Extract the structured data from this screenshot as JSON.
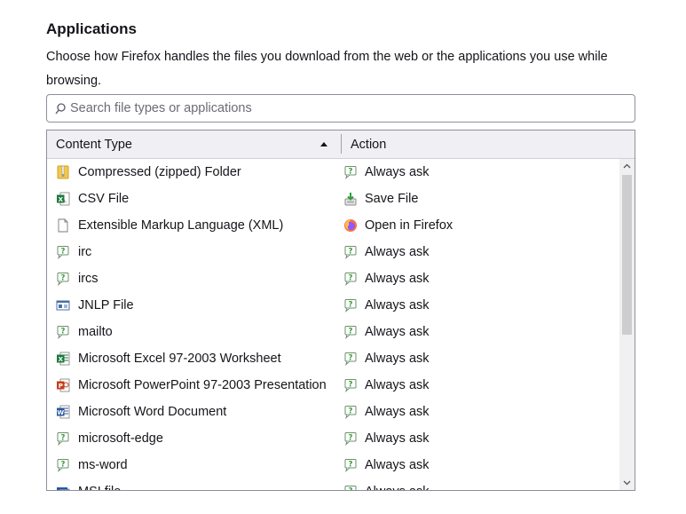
{
  "section": {
    "title": "Applications",
    "description": "Choose how Firefox handles the files you download from the web or the applications you use while browsing."
  },
  "search": {
    "placeholder": "Search file types or applications",
    "value": ""
  },
  "table": {
    "headers": {
      "content_type": "Content Type",
      "action": "Action"
    },
    "sort": "content_type ascending",
    "rows": [
      {
        "type": "Compressed (zipped) Folder",
        "type_icon": "zip-folder-icon",
        "action": "Always ask",
        "action_icon": "ask-icon"
      },
      {
        "type": "CSV File",
        "type_icon": "excel-csv-icon",
        "action": "Save File",
        "action_icon": "save-file-icon"
      },
      {
        "type": "Extensible Markup Language (XML)",
        "type_icon": "blank-file-icon",
        "action": "Open in Firefox",
        "action_icon": "firefox-icon"
      },
      {
        "type": "irc",
        "type_icon": "ask-icon",
        "action": "Always ask",
        "action_icon": "ask-icon"
      },
      {
        "type": "ircs",
        "type_icon": "ask-icon",
        "action": "Always ask",
        "action_icon": "ask-icon"
      },
      {
        "type": "JNLP File",
        "type_icon": "jnlp-icon",
        "action": "Always ask",
        "action_icon": "ask-icon"
      },
      {
        "type": "mailto",
        "type_icon": "ask-icon",
        "action": "Always ask",
        "action_icon": "ask-icon"
      },
      {
        "type": "Microsoft Excel 97-2003 Worksheet",
        "type_icon": "excel-icon",
        "action": "Always ask",
        "action_icon": "ask-icon"
      },
      {
        "type": "Microsoft PowerPoint 97-2003 Presentation",
        "type_icon": "powerpoint-icon",
        "action": "Always ask",
        "action_icon": "ask-icon"
      },
      {
        "type": "Microsoft Word Document",
        "type_icon": "word-icon",
        "action": "Always ask",
        "action_icon": "ask-icon"
      },
      {
        "type": "microsoft-edge",
        "type_icon": "ask-icon",
        "action": "Always ask",
        "action_icon": "ask-icon"
      },
      {
        "type": "ms-word",
        "type_icon": "ask-icon",
        "action": "Always ask",
        "action_icon": "ask-icon"
      },
      {
        "type": "MSI file",
        "type_icon": "msi-icon",
        "action": "Always ask",
        "action_icon": "ask-icon"
      }
    ]
  },
  "colors": {
    "text": "#15141a",
    "header_bg": "#f0f0f4",
    "border": "#8f8f9d",
    "excel_green": "#1d7a3e",
    "powerpoint_red": "#c43e1c",
    "word_blue": "#2b579a",
    "ask_green": "#3a9a3a"
  }
}
